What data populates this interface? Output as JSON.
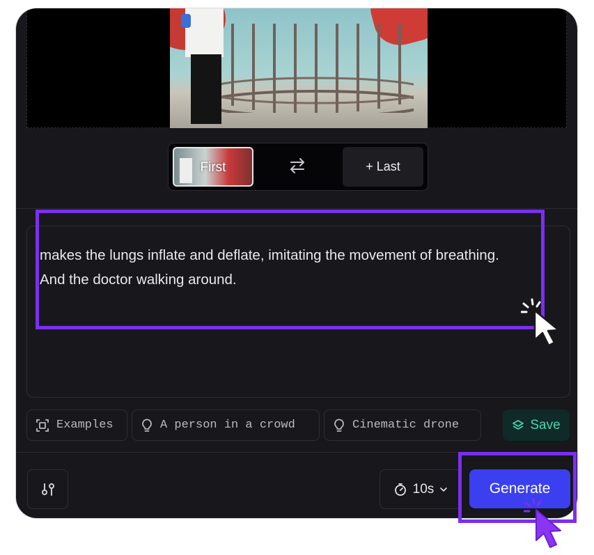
{
  "frames": {
    "first_label": "First",
    "last_label": "+ Last"
  },
  "prompt": {
    "text": "makes the lungs inflate and deflate, imitating the movement of breathing.\nAnd the doctor walking around."
  },
  "chips": [
    {
      "label": "Examples",
      "icon": "frame-scan-icon"
    },
    {
      "label": "A person in a crowd",
      "icon": "lightbulb-icon"
    },
    {
      "label": "Cinematic drone",
      "icon": "lightbulb-icon"
    }
  ],
  "save_label": "Save",
  "duration": {
    "value": "10s"
  },
  "generate_label": "Generate",
  "colors": {
    "panel_bg": "#17171c",
    "accent": "#3b3ff0",
    "highlight": "#7b2ff0",
    "save_text": "#49d6b0"
  }
}
